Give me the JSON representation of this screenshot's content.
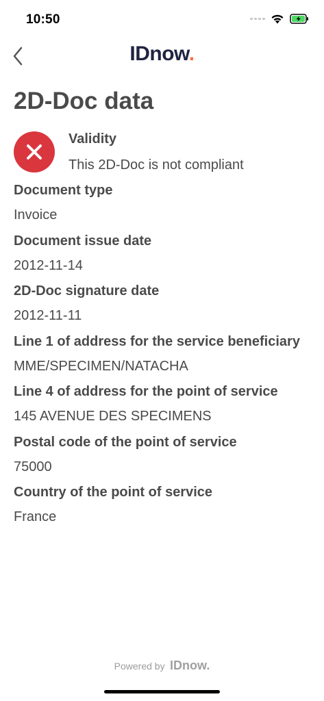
{
  "status_bar": {
    "time": "10:50",
    "icons": [
      "cellular-signal-icon",
      "wifi-icon",
      "battery-charging-icon"
    ],
    "battery_color": "#4cd964"
  },
  "nav": {
    "back_icon": "chevron-left-icon",
    "brand_name": "IDnow",
    "brand_dot": ".",
    "brand_color": "#1f2440",
    "brand_accent": "#ff6c3e"
  },
  "page": {
    "title": "2D-Doc data"
  },
  "validity": {
    "icon": "close-circle-icon",
    "icon_color": "#d9363e",
    "heading": "Validity",
    "status_text": "This 2D-Doc is not compliant"
  },
  "fields": [
    {
      "label": "Document type",
      "value": "Invoice"
    },
    {
      "label": "Document issue date",
      "value": "2012-11-14"
    },
    {
      "label": "2D-Doc signature date",
      "value": "2012-11-11"
    },
    {
      "label": "Line 1 of address for the service beneficiary",
      "value": "MME/SPECIMEN/NATACHA"
    },
    {
      "label": "Line 4 of address for the point of service",
      "value": "145 AVENUE DES SPECIMENS"
    },
    {
      "label": "Postal code of the point of service",
      "value": "75000"
    },
    {
      "label": "Country of the point of service",
      "value": "France"
    }
  ],
  "footer": {
    "powered_by": "Powered by",
    "logo_text": "IDnow."
  }
}
